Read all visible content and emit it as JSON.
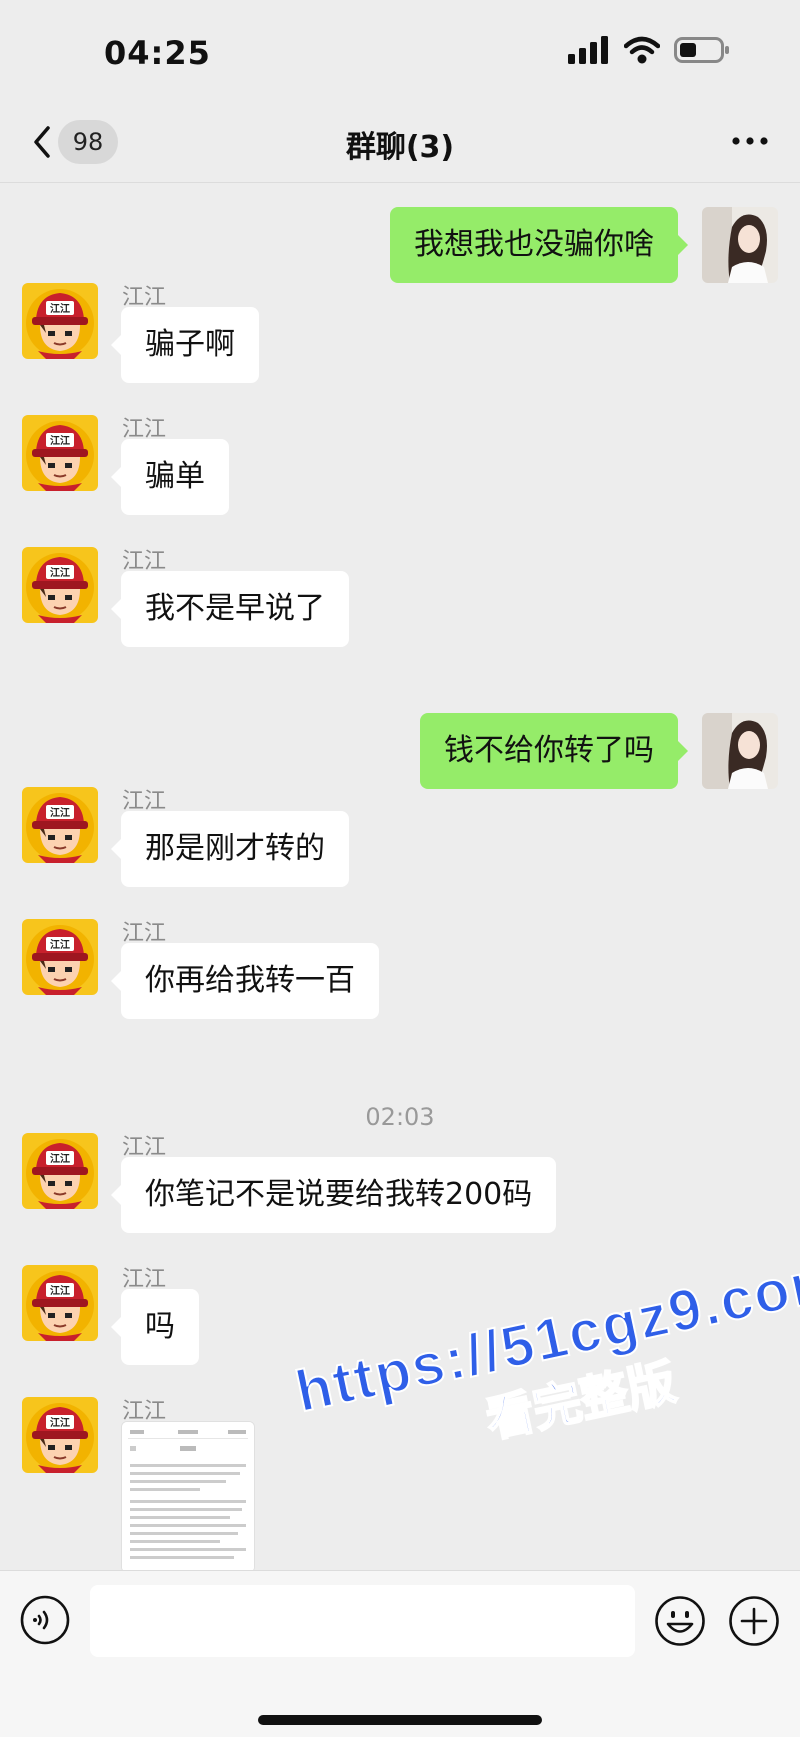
{
  "status_bar": {
    "time": "04:25"
  },
  "header": {
    "back_count": "98",
    "title": "群聊(3)"
  },
  "timestamp": "02:03",
  "messages": [
    {
      "side": "out",
      "text": "我想我也没骗你啥"
    },
    {
      "side": "in",
      "sender": "江江",
      "text": "骗子啊"
    },
    {
      "side": "in",
      "sender": "江江",
      "text": "骗单"
    },
    {
      "side": "in",
      "sender": "江江",
      "text": "我不是早说了"
    },
    {
      "side": "out",
      "text": "钱不给你转了吗"
    },
    {
      "side": "in",
      "sender": "江江",
      "text": "那是刚才转的"
    },
    {
      "side": "in",
      "sender": "江江",
      "text": "你再给我转一百"
    },
    {
      "side": "in",
      "sender": "江江",
      "text": "你笔记不是说要给我转200码"
    },
    {
      "side": "in",
      "sender": "江江",
      "text": "吗"
    },
    {
      "side": "in",
      "sender": "江江",
      "type": "image"
    }
  ],
  "avatar_cap_text": "江江",
  "watermark": {
    "url": "https://51cgz9.com",
    "text": "看完整版"
  },
  "input_bar": {
    "placeholder": ""
  },
  "colors": {
    "outgoing_bubble": "#95ec69",
    "incoming_bubble": "#ffffff",
    "background": "#ededed",
    "watermark": "#2f5fe8"
  }
}
